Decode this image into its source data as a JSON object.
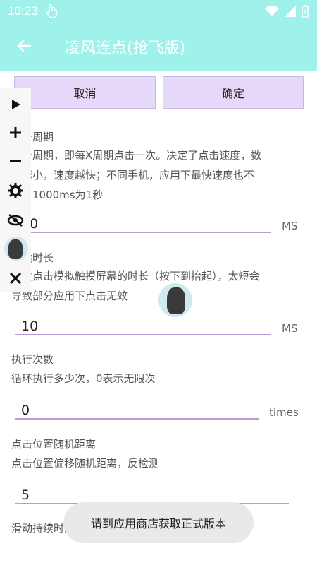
{
  "status": {
    "time": "10:23"
  },
  "appbar": {
    "title": "凌风连点(抢飞版)"
  },
  "actions": {
    "cancel": "取消",
    "confirm": "确定"
  },
  "sections": {
    "period": {
      "title": "点击周期",
      "desc_line1": "点击周期，即每X周期点击一次。决定了点击速度，数",
      "desc_line2": "值越小，速度越快；不同手机，应用下最快速度也不",
      "desc_line3": "同，1000ms为1秒",
      "value": "50",
      "unit": "MS"
    },
    "duration": {
      "title": "持续时长",
      "desc_line1": "每次点击模拟触摸屏幕的时长（按下到抬起），太短会",
      "desc_line2": "导致部分应用下点击无效",
      "value": "10",
      "unit": "MS"
    },
    "count": {
      "title": "执行次数",
      "desc": "循环执行多少次，0表示无限次",
      "value": "0",
      "unit": "times"
    },
    "random": {
      "title": "点击位置随机距离",
      "desc": "点击位置偏移随机距离，反检测",
      "value": "5"
    },
    "swipe": {
      "title": "滑动持续时间"
    }
  },
  "toast": {
    "text": "请到应用商店获取正式版本"
  },
  "colors": {
    "header": "#9ff2ec",
    "button": "#e6d8f8",
    "underline": "#b79bd6"
  }
}
